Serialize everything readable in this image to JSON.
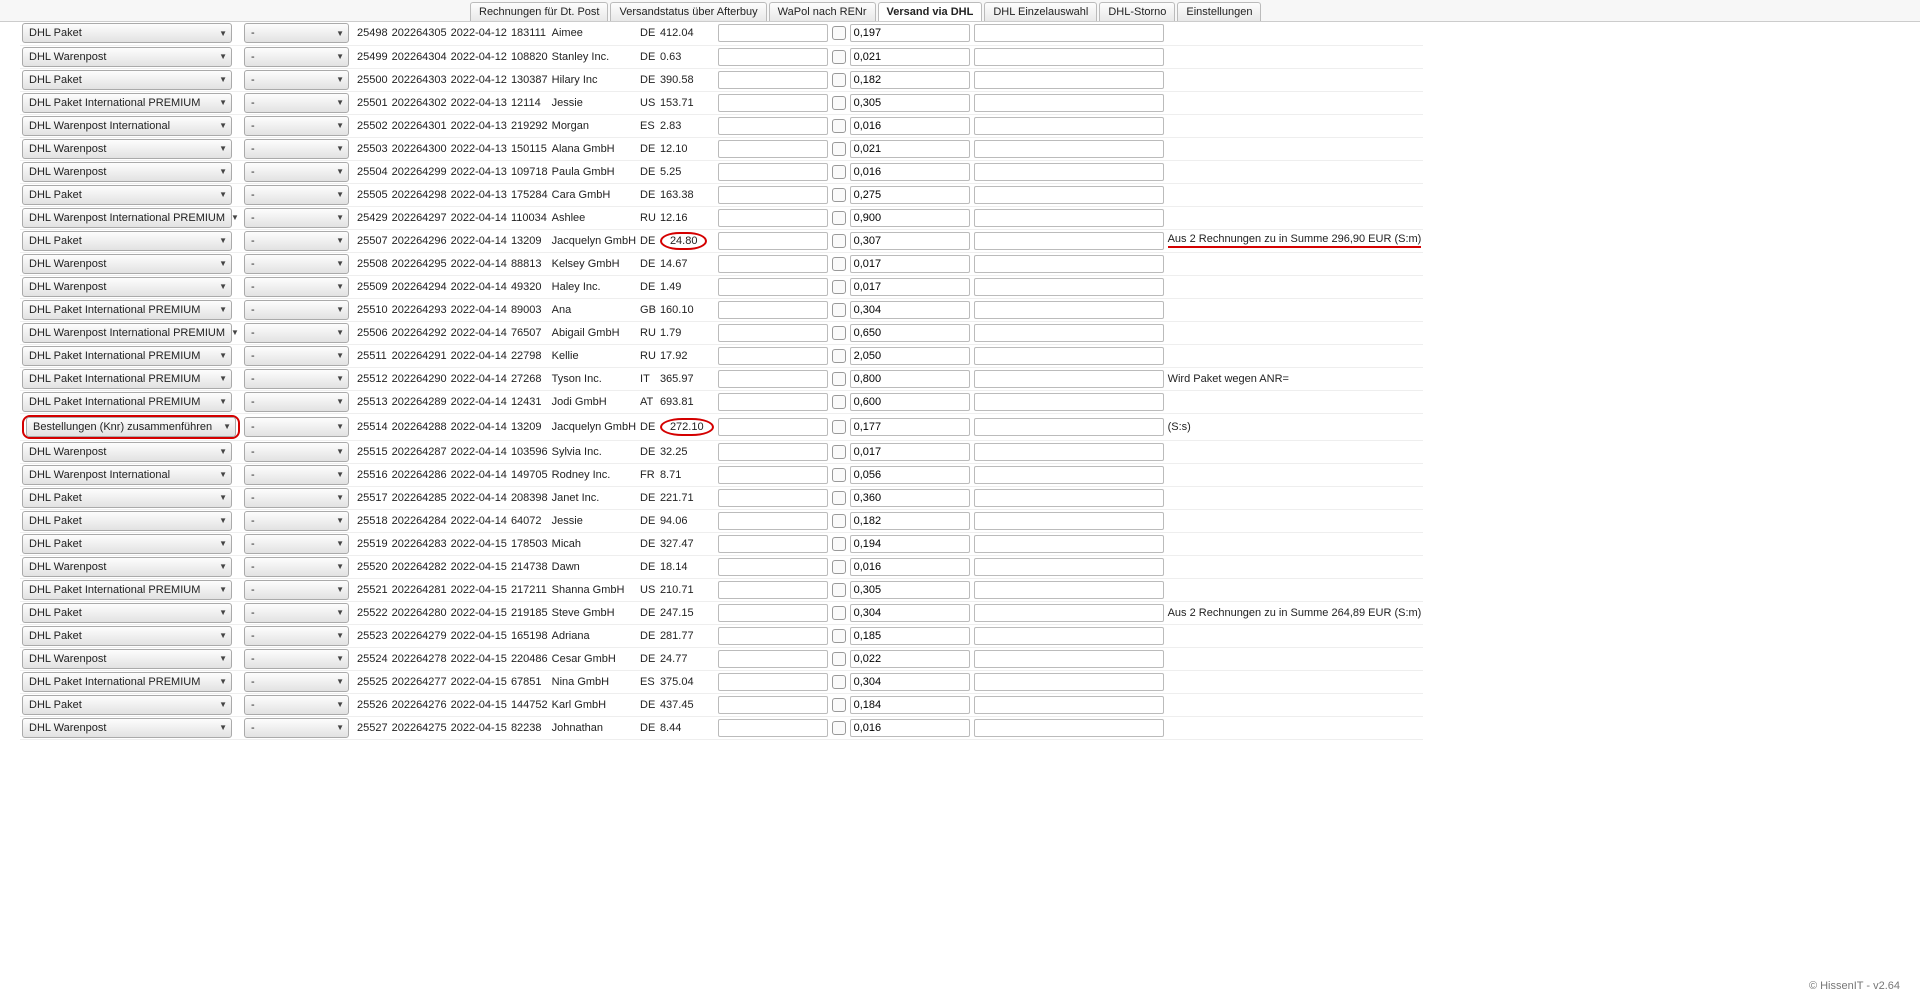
{
  "tabs": [
    {
      "label": "Rechnungen für Dt. Post",
      "active": false
    },
    {
      "label": "Versandstatus über Afterbuy",
      "active": false
    },
    {
      "label": "WaPol nach RENr",
      "active": false
    },
    {
      "label": "Versand via DHL",
      "active": true
    },
    {
      "label": "DHL Einzelauswahl",
      "active": false
    },
    {
      "label": "DHL-Storno",
      "active": false
    },
    {
      "label": "Einstellungen",
      "active": false
    }
  ],
  "footer": "© HissenIT - v2.64",
  "rows": [
    {
      "ship": "DHL Paket",
      "sub": "-",
      "id": "25498",
      "order": "202264305",
      "date": "2022-04-12",
      "knr": "183111",
      "name": "Aimee",
      "cty": "DE",
      "amt": "412.04",
      "w": "0,197",
      "note": "",
      "hl": {}
    },
    {
      "ship": "DHL Warenpost",
      "sub": "-",
      "id": "25499",
      "order": "202264304",
      "date": "2022-04-12",
      "knr": "108820",
      "name": "Stanley Inc.",
      "cty": "DE",
      "amt": "0.63",
      "w": "0,021",
      "note": "",
      "hl": {}
    },
    {
      "ship": "DHL Paket",
      "sub": "-",
      "id": "25500",
      "order": "202264303",
      "date": "2022-04-12",
      "knr": "130387",
      "name": "Hilary Inc",
      "cty": "DE",
      "amt": "390.58",
      "w": "0,182",
      "note": "",
      "hl": {}
    },
    {
      "ship": "DHL Paket International PREMIUM",
      "sub": "-",
      "id": "25501",
      "order": "202264302",
      "date": "2022-04-13",
      "knr": "12114",
      "name": "Jessie",
      "cty": "US",
      "amt": "153.71",
      "w": "0,305",
      "note": "",
      "hl": {}
    },
    {
      "ship": "DHL Warenpost International",
      "sub": "-",
      "id": "25502",
      "order": "202264301",
      "date": "2022-04-13",
      "knr": "219292",
      "name": "Morgan",
      "cty": "ES",
      "amt": "2.83",
      "w": "0,016",
      "note": "",
      "hl": {}
    },
    {
      "ship": "DHL Warenpost",
      "sub": "-",
      "id": "25503",
      "order": "202264300",
      "date": "2022-04-13",
      "knr": "150115",
      "name": "Alana GmbH",
      "cty": "DE",
      "amt": "12.10",
      "w": "0,021",
      "note": "",
      "hl": {}
    },
    {
      "ship": "DHL Warenpost",
      "sub": "-",
      "id": "25504",
      "order": "202264299",
      "date": "2022-04-13",
      "knr": "109718",
      "name": "Paula GmbH",
      "cty": "DE",
      "amt": "5.25",
      "w": "0,016",
      "note": "",
      "hl": {}
    },
    {
      "ship": "DHL Paket",
      "sub": "-",
      "id": "25505",
      "order": "202264298",
      "date": "2022-04-13",
      "knr": "175284",
      "name": "Cara GmbH",
      "cty": "DE",
      "amt": "163.38",
      "w": "0,275",
      "note": "",
      "hl": {}
    },
    {
      "ship": "DHL Warenpost International PREMIUM",
      "sub": "-",
      "id": "25429",
      "order": "202264297",
      "date": "2022-04-14",
      "knr": "110034",
      "name": "Ashlee",
      "cty": "RU",
      "amt": "12.16",
      "w": "0,900",
      "note": "",
      "hl": {}
    },
    {
      "ship": "DHL Paket",
      "sub": "-",
      "id": "25507",
      "order": "202264296",
      "date": "2022-04-14",
      "knr": "13209",
      "name": "Jacquelyn GmbH",
      "cty": "DE",
      "amt": "24.80",
      "w": "0,307",
      "note": "Aus 2 Rechnungen zu in Summe 296,90 EUR (S:m)",
      "hl": {
        "amt": "circle",
        "note": "ul"
      }
    },
    {
      "ship": "DHL Warenpost",
      "sub": "-",
      "id": "25508",
      "order": "202264295",
      "date": "2022-04-14",
      "knr": "88813",
      "name": "Kelsey GmbH",
      "cty": "DE",
      "amt": "14.67",
      "w": "0,017",
      "note": "",
      "hl": {}
    },
    {
      "ship": "DHL Warenpost",
      "sub": "-",
      "id": "25509",
      "order": "202264294",
      "date": "2022-04-14",
      "knr": "49320",
      "name": "Haley Inc.",
      "cty": "DE",
      "amt": "1.49",
      "w": "0,017",
      "note": "",
      "hl": {}
    },
    {
      "ship": "DHL Paket International PREMIUM",
      "sub": "-",
      "id": "25510",
      "order": "202264293",
      "date": "2022-04-14",
      "knr": "89003",
      "name": "Ana",
      "cty": "GB",
      "amt": "160.10",
      "w": "0,304",
      "note": "",
      "hl": {}
    },
    {
      "ship": "DHL Warenpost International PREMIUM",
      "sub": "-",
      "id": "25506",
      "order": "202264292",
      "date": "2022-04-14",
      "knr": "76507",
      "name": "Abigail GmbH",
      "cty": "RU",
      "amt": "1.79",
      "w": "0,650",
      "note": "",
      "hl": {}
    },
    {
      "ship": "DHL Paket International PREMIUM",
      "sub": "-",
      "id": "25511",
      "order": "202264291",
      "date": "2022-04-14",
      "knr": "22798",
      "name": "Kellie",
      "cty": "RU",
      "amt": "17.92",
      "w": "2,050",
      "note": "",
      "hl": {}
    },
    {
      "ship": "DHL Paket International PREMIUM",
      "sub": "-",
      "id": "25512",
      "order": "202264290",
      "date": "2022-04-14",
      "knr": "27268",
      "name": "Tyson Inc.",
      "cty": "IT",
      "amt": "365.97",
      "w": "0,800",
      "note": "Wird Paket wegen ANR=",
      "hl": {}
    },
    {
      "ship": "DHL Paket International PREMIUM",
      "sub": "-",
      "id": "25513",
      "order": "202264289",
      "date": "2022-04-14",
      "knr": "12431",
      "name": "Jodi GmbH",
      "cty": "AT",
      "amt": "693.81",
      "w": "0,600",
      "note": "",
      "hl": {}
    },
    {
      "ship": "Bestellungen (Knr) zusammenführen",
      "sub": "-",
      "id": "25514",
      "order": "202264288",
      "date": "2022-04-14",
      "knr": "13209",
      "name": "Jacquelyn GmbH",
      "cty": "DE",
      "amt": "272.10",
      "w": "0,177",
      "note": "(S:s)",
      "hl": {
        "ship": "box",
        "amt": "circle"
      }
    },
    {
      "ship": "DHL Warenpost",
      "sub": "-",
      "id": "25515",
      "order": "202264287",
      "date": "2022-04-14",
      "knr": "103596",
      "name": "Sylvia Inc.",
      "cty": "DE",
      "amt": "32.25",
      "w": "0,017",
      "note": "",
      "hl": {}
    },
    {
      "ship": "DHL Warenpost International",
      "sub": "-",
      "id": "25516",
      "order": "202264286",
      "date": "2022-04-14",
      "knr": "149705",
      "name": "Rodney Inc.",
      "cty": "FR",
      "amt": "8.71",
      "w": "0,056",
      "note": "",
      "hl": {}
    },
    {
      "ship": "DHL Paket",
      "sub": "-",
      "id": "25517",
      "order": "202264285",
      "date": "2022-04-14",
      "knr": "208398",
      "name": "Janet Inc.",
      "cty": "DE",
      "amt": "221.71",
      "w": "0,360",
      "note": "",
      "hl": {}
    },
    {
      "ship": "DHL Paket",
      "sub": "-",
      "id": "25518",
      "order": "202264284",
      "date": "2022-04-14",
      "knr": "64072",
      "name": "Jessie",
      "cty": "DE",
      "amt": "94.06",
      "w": "0,182",
      "note": "",
      "hl": {}
    },
    {
      "ship": "DHL Paket",
      "sub": "-",
      "id": "25519",
      "order": "202264283",
      "date": "2022-04-15",
      "knr": "178503",
      "name": "Micah",
      "cty": "DE",
      "amt": "327.47",
      "w": "0,194",
      "note": "",
      "hl": {}
    },
    {
      "ship": "DHL Warenpost",
      "sub": "-",
      "id": "25520",
      "order": "202264282",
      "date": "2022-04-15",
      "knr": "214738",
      "name": "Dawn",
      "cty": "DE",
      "amt": "18.14",
      "w": "0,016",
      "note": "",
      "hl": {}
    },
    {
      "ship": "DHL Paket International PREMIUM",
      "sub": "-",
      "id": "25521",
      "order": "202264281",
      "date": "2022-04-15",
      "knr": "217211",
      "name": "Shanna GmbH",
      "cty": "US",
      "amt": "210.71",
      "w": "0,305",
      "note": "",
      "hl": {}
    },
    {
      "ship": "DHL Paket",
      "sub": "-",
      "id": "25522",
      "order": "202264280",
      "date": "2022-04-15",
      "knr": "219185",
      "name": "Steve GmbH",
      "cty": "DE",
      "amt": "247.15",
      "w": "0,304",
      "note": "Aus 2 Rechnungen zu in Summe 264,89 EUR (S:m)",
      "hl": {}
    },
    {
      "ship": "DHL Paket",
      "sub": "-",
      "id": "25523",
      "order": "202264279",
      "date": "2022-04-15",
      "knr": "165198",
      "name": "Adriana",
      "cty": "DE",
      "amt": "281.77",
      "w": "0,185",
      "note": "",
      "hl": {}
    },
    {
      "ship": "DHL Warenpost",
      "sub": "-",
      "id": "25524",
      "order": "202264278",
      "date": "2022-04-15",
      "knr": "220486",
      "name": "Cesar GmbH",
      "cty": "DE",
      "amt": "24.77",
      "w": "0,022",
      "note": "",
      "hl": {}
    },
    {
      "ship": "DHL Paket International PREMIUM",
      "sub": "-",
      "id": "25525",
      "order": "202264277",
      "date": "2022-04-15",
      "knr": "67851",
      "name": "Nina GmbH",
      "cty": "ES",
      "amt": "375.04",
      "w": "0,304",
      "note": "",
      "hl": {}
    },
    {
      "ship": "DHL Paket",
      "sub": "-",
      "id": "25526",
      "order": "202264276",
      "date": "2022-04-15",
      "knr": "144752",
      "name": "Karl GmbH",
      "cty": "DE",
      "amt": "437.45",
      "w": "0,184",
      "note": "",
      "hl": {}
    },
    {
      "ship": "DHL Warenpost",
      "sub": "-",
      "id": "25527",
      "order": "202264275",
      "date": "2022-04-15",
      "knr": "82238",
      "name": "Johnathan",
      "cty": "DE",
      "amt": "8.44",
      "w": "0,016",
      "note": "",
      "hl": {}
    }
  ]
}
